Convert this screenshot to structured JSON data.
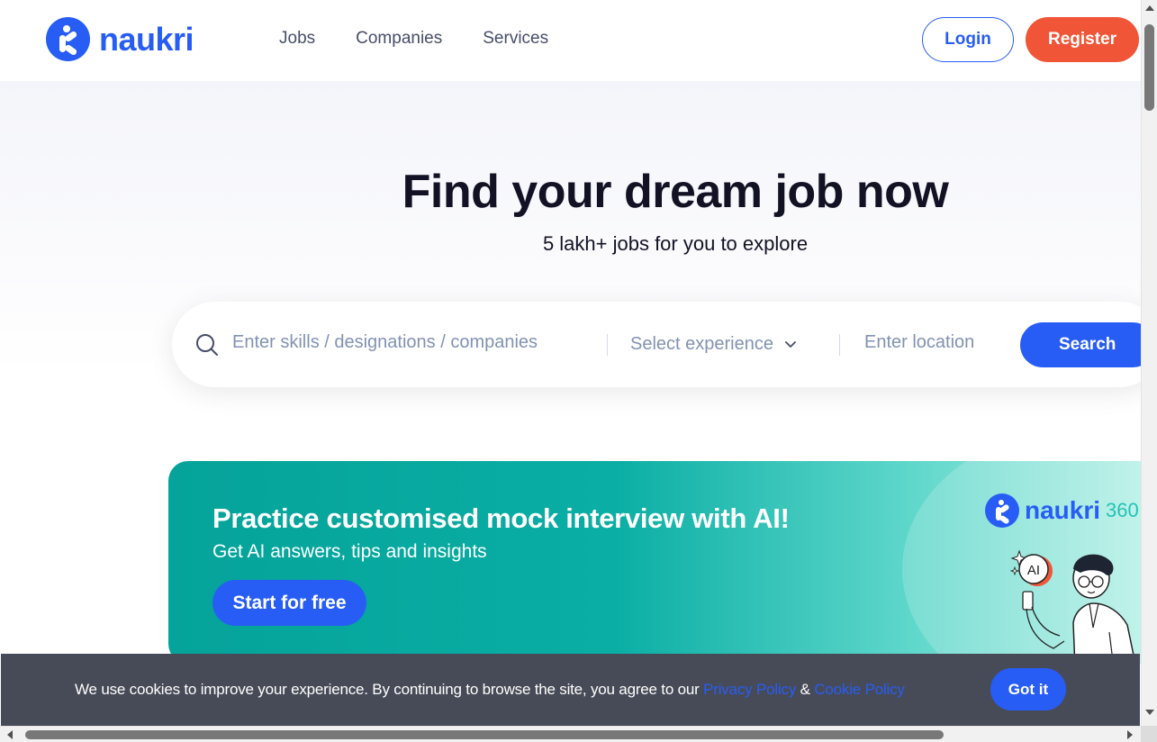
{
  "header": {
    "logo_text": "naukri",
    "nav": [
      {
        "label": "Jobs"
      },
      {
        "label": "Companies"
      },
      {
        "label": "Services"
      }
    ],
    "login_label": "Login",
    "register_label": "Register"
  },
  "hero": {
    "title": "Find your dream job now",
    "subtitle": "5 lakh+ jobs for you to explore"
  },
  "search": {
    "skills_placeholder": "Enter skills / designations / companies",
    "experience_label": "Select experience",
    "location_placeholder": "Enter location",
    "button_label": "Search"
  },
  "promo": {
    "title": "Practice customised mock interview with AI!",
    "subtitle": "Get AI answers, tips and insights",
    "button_label": "Start for free",
    "brand_text": "naukri",
    "brand_suffix": "360",
    "ai_badge": "AI"
  },
  "cookie": {
    "text": "We use cookies to improve your experience. By continuing to browse the site, you agree to our",
    "privacy_link": "Privacy Policy",
    "ampersand": "&",
    "cookie_link": "Cookie Policy",
    "button_label": "Got it"
  },
  "colors": {
    "brand_blue": "#275df5",
    "register_orange": "#f05537",
    "promo_teal": "#05a39a",
    "cookie_bg": "#474b57"
  },
  "icons": [
    "search-icon",
    "chevron-down-icon",
    "naukri-logo-icon"
  ]
}
